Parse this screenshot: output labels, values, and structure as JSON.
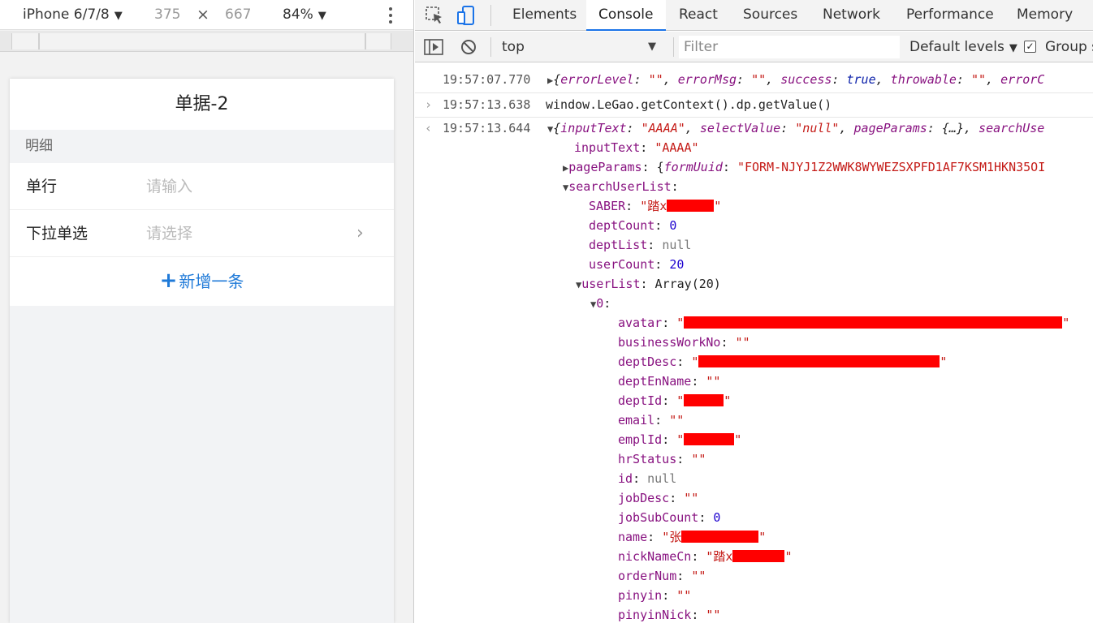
{
  "device_toolbar": {
    "device": "iPhone 6/7/8",
    "width": "375",
    "times": "×",
    "height": "667",
    "zoom": "84%"
  },
  "phone": {
    "title": "单据-2",
    "section": "明细",
    "rows": [
      {
        "label": "单行",
        "placeholder": "请输入"
      },
      {
        "label": "下拉单选",
        "placeholder": "请选择"
      }
    ],
    "add_label": "新增一条",
    "add_plus": "+"
  },
  "devtools": {
    "tabs": [
      "Elements",
      "Console",
      "React",
      "Sources",
      "Network",
      "Performance",
      "Memory"
    ],
    "active_tab": "Console",
    "context": "top",
    "filter_placeholder": "Filter",
    "levels": "Default levels",
    "group_label": "Group s",
    "accent": "#1a73e8"
  },
  "console": {
    "line1": {
      "ts": "19:57:07.770",
      "a": "{",
      "k1": "errorLevel",
      "v1": "\"\"",
      "k2": "errorMsg",
      "v2": "\"\"",
      "k3": "success",
      "v3": "true",
      "k4": "throwable",
      "v4": "\"\"",
      "k5": "errorC"
    },
    "line2": {
      "ts": "19:57:13.638",
      "cmd": "window.LeGao.getContext().dp.getValue()"
    },
    "line3": {
      "ts": "19:57:13.644",
      "k1": "inputText",
      "v1": "\"AAAA\"",
      "k2": "selectValue",
      "v2": "\"null\"",
      "k3": "pageParams",
      "v3": "{…}",
      "k4": "searchUse"
    },
    "inputText": {
      "key": "inputText",
      "val": "\"AAAA\""
    },
    "pageParams": {
      "key": "pageParams",
      "inner_key": "formUuid",
      "val": "\"FORM-NJYJ1Z2WWK8WYWEZSXPFD1AF7KSM1HKN35OI"
    },
    "searchUserList": {
      "key": "searchUserList"
    },
    "SABER": {
      "key": "SABER",
      "prefix": "\"踏x"
    },
    "deptCount": {
      "key": "deptCount",
      "val": "0"
    },
    "deptList": {
      "key": "deptList",
      "val": "null"
    },
    "userCount": {
      "key": "userCount",
      "val": "20"
    },
    "userList": {
      "key": "userList",
      "val": "Array(20)"
    },
    "item0": {
      "key": "0"
    },
    "fields": {
      "avatar": "avatar",
      "businessWorkNo": "businessWorkNo",
      "deptDesc": "deptDesc",
      "deptEnName": "deptEnName",
      "deptId": "deptId",
      "email": "email",
      "emplId": "emplId",
      "hrStatus": "hrStatus",
      "id": "id",
      "jobDesc": "jobDesc",
      "jobSubCount": "jobSubCount",
      "name": "name",
      "nickNameCn": "nickNameCn",
      "orderNum": "orderNum",
      "pinyin": "pinyin",
      "pinyinNick": "pinyinNick"
    },
    "values": {
      "empty": "\"\"",
      "id": "null",
      "jobSubCount": "0",
      "name_prefix": "\"张",
      "nick_prefix": "\"踏x"
    }
  }
}
